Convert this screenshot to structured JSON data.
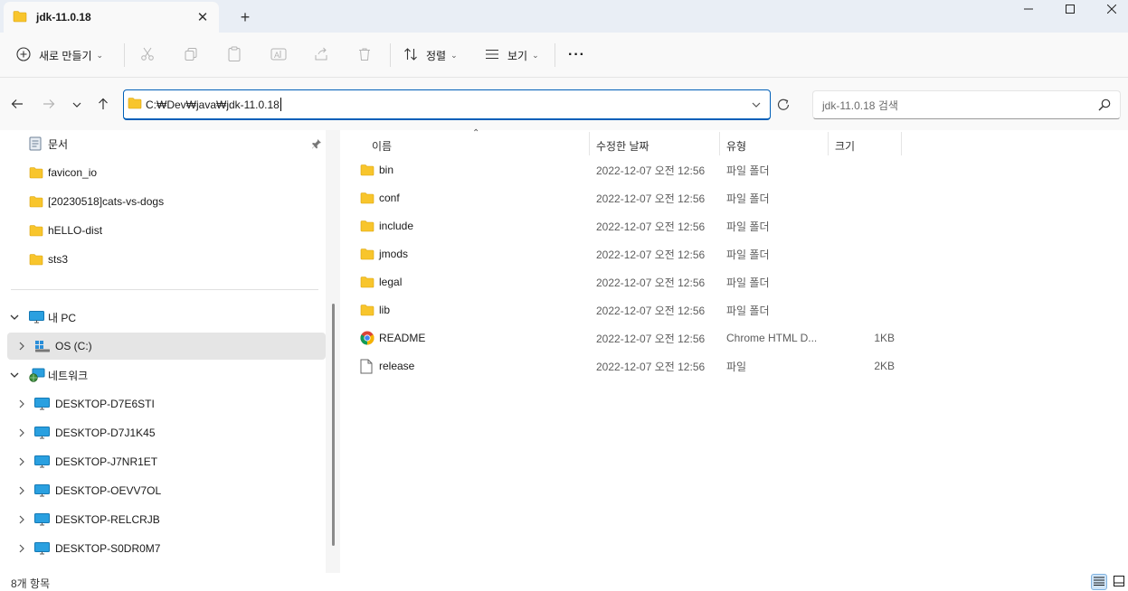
{
  "window": {
    "tab_title": "jdk-11.0.18",
    "tab_close": "✕",
    "new_tab": "+"
  },
  "toolbar": {
    "new_label": "새로 만들기",
    "sort_label": "정렬",
    "view_label": "보기",
    "more_label": "···"
  },
  "address": {
    "path": "C:₩Dev₩java₩jdk-11.0.18",
    "search_placeholder": "jdk-11.0.18 검색"
  },
  "sidebar": {
    "quick": [
      {
        "label": "문서",
        "icon": "document-icon",
        "pinned": true
      },
      {
        "label": "favicon_io",
        "icon": "folder-icon"
      },
      {
        "label": "[20230518]cats-vs-dogs",
        "icon": "folder-icon"
      },
      {
        "label": "hELLO-dist",
        "icon": "folder-icon"
      },
      {
        "label": "sts3",
        "icon": "folder-icon"
      }
    ],
    "this_pc": "내 PC",
    "drive": "OS (C:)",
    "network": "네트워크",
    "computers": [
      "DESKTOP-D7E6STI",
      "DESKTOP-D7J1K45",
      "DESKTOP-J7NR1ET",
      "DESKTOP-OEVV7OL",
      "DESKTOP-RELCRJB",
      "DESKTOP-S0DR0M7"
    ]
  },
  "columns": {
    "name": "이름",
    "date": "수정한 날짜",
    "type": "유형",
    "size": "크기"
  },
  "files": [
    {
      "name": "bin",
      "date": "2022-12-07 오전 12:56",
      "type": "파일 폴더",
      "size": "",
      "icon": "folder-icon"
    },
    {
      "name": "conf",
      "date": "2022-12-07 오전 12:56",
      "type": "파일 폴더",
      "size": "",
      "icon": "folder-icon"
    },
    {
      "name": "include",
      "date": "2022-12-07 오전 12:56",
      "type": "파일 폴더",
      "size": "",
      "icon": "folder-icon"
    },
    {
      "name": "jmods",
      "date": "2022-12-07 오전 12:56",
      "type": "파일 폴더",
      "size": "",
      "icon": "folder-icon"
    },
    {
      "name": "legal",
      "date": "2022-12-07 오전 12:56",
      "type": "파일 폴더",
      "size": "",
      "icon": "folder-icon"
    },
    {
      "name": "lib",
      "date": "2022-12-07 오전 12:56",
      "type": "파일 폴더",
      "size": "",
      "icon": "folder-icon"
    },
    {
      "name": "README",
      "date": "2022-12-07 오전 12:56",
      "type": "Chrome HTML D...",
      "size": "1KB",
      "icon": "chrome-icon"
    },
    {
      "name": "release",
      "date": "2022-12-07 오전 12:56",
      "type": "파일",
      "size": "2KB",
      "icon": "file-icon"
    }
  ],
  "status": {
    "count": "8개 항목"
  },
  "colors": {
    "accent": "#005fb8",
    "folder": "#f8c52c",
    "selected": "#e5e5e5"
  }
}
